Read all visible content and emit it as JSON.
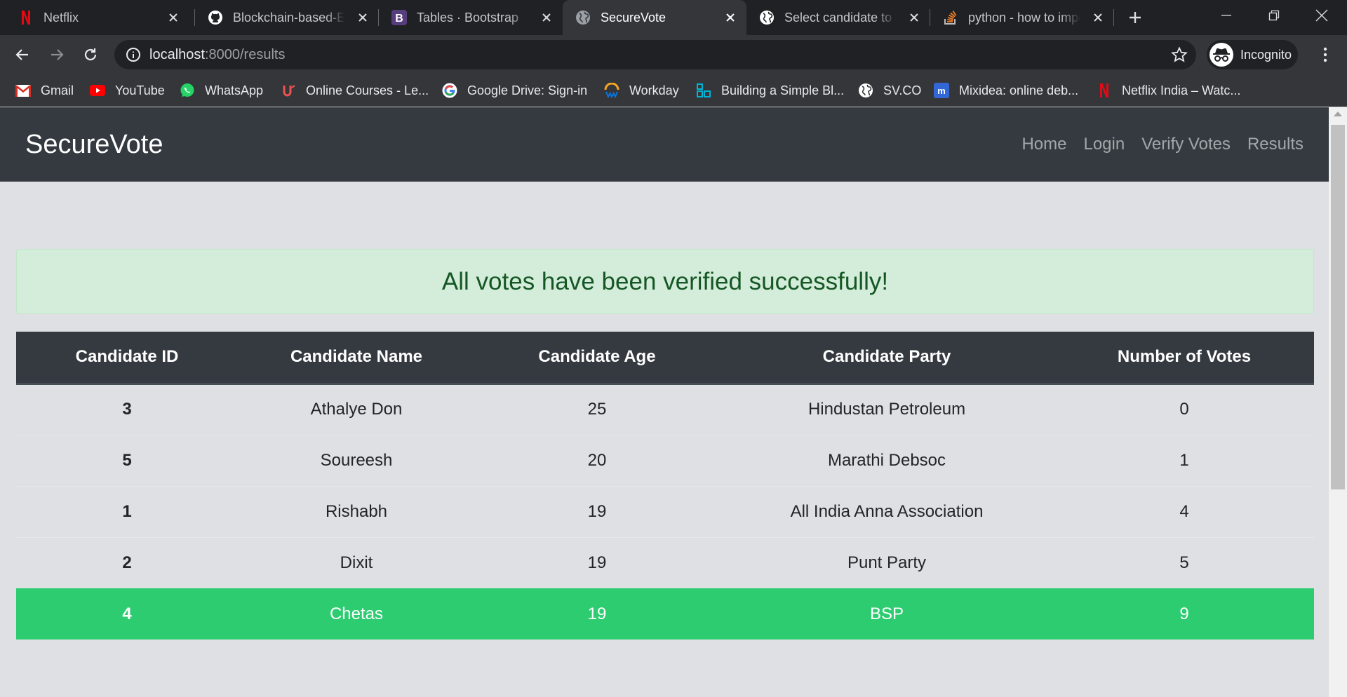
{
  "browser": {
    "tabs": [
      {
        "title": "Netflix",
        "favicon": "netflix-icon"
      },
      {
        "title": "Blockchain-based-E-Voting",
        "favicon": "github-icon"
      },
      {
        "title": "Tables · Bootstrap",
        "favicon": "bootstrap-icon"
      },
      {
        "title": "SecureVote",
        "favicon": "globe-icon",
        "active": true
      },
      {
        "title": "Select candidate to cast vote",
        "favicon": "globe-icon"
      },
      {
        "title": "python - how to import module",
        "favicon": "stackoverflow-icon"
      }
    ],
    "address_bar": {
      "host": "localhost",
      "path": ":8000/results"
    },
    "profile_label": "Incognito",
    "bookmarks": [
      {
        "label": "Gmail",
        "icon": "gmail-icon"
      },
      {
        "label": "YouTube",
        "icon": "youtube-icon"
      },
      {
        "label": "WhatsApp",
        "icon": "whatsapp-icon"
      },
      {
        "label": "Online Courses - Le...",
        "icon": "udemy-icon"
      },
      {
        "label": "Google Drive: Sign-in",
        "icon": "google-icon"
      },
      {
        "label": "Workday",
        "icon": "workday-icon"
      },
      {
        "label": "Building a Simple Bl...",
        "icon": "blocks-icon"
      },
      {
        "label": "SV.CO",
        "icon": "globe-icon"
      },
      {
        "label": "Mixidea: online deb...",
        "icon": "mixidea-icon"
      },
      {
        "label": "Netflix India – Watc...",
        "icon": "netflix-icon"
      }
    ]
  },
  "site": {
    "brand": "SecureVote",
    "nav": [
      "Home",
      "Login",
      "Verify Votes",
      "Results"
    ]
  },
  "alert": {
    "message": "All votes have been verified successfully!"
  },
  "table": {
    "headers": [
      "Candidate ID",
      "Candidate Name",
      "Candidate Age",
      "Candidate Party",
      "Number of Votes"
    ],
    "rows": [
      {
        "id": "3",
        "name": "Athalye Don",
        "age": "25",
        "party": "Hindustan Petroleum",
        "votes": "0"
      },
      {
        "id": "5",
        "name": "Soureesh",
        "age": "20",
        "party": "Marathi Debsoc",
        "votes": "1"
      },
      {
        "id": "1",
        "name": "Rishabh",
        "age": "19",
        "party": "All India Anna Association",
        "votes": "4"
      },
      {
        "id": "2",
        "name": "Dixit",
        "age": "19",
        "party": "Punt Party",
        "votes": "5"
      },
      {
        "id": "4",
        "name": "Chetas",
        "age": "19",
        "party": "BSP",
        "votes": "9",
        "highlighted": true
      }
    ]
  },
  "colors": {
    "navbar": "#343a40",
    "alert_bg": "#d4edda",
    "alert_text": "#155724",
    "winner_row": "#2ecc71"
  }
}
